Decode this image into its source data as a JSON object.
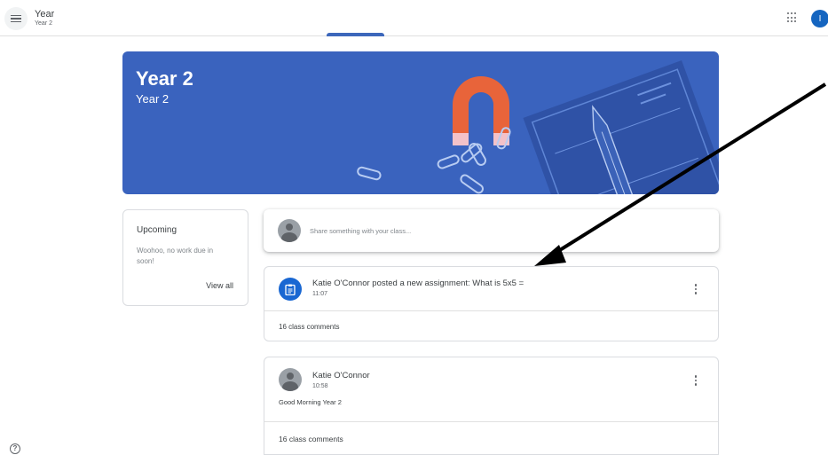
{
  "header": {
    "class_name": "Year",
    "class_section": "Year 2",
    "account_initial": "I"
  },
  "banner": {
    "title": "Year 2",
    "subtitle": "Year 2"
  },
  "upcoming": {
    "title": "Upcoming",
    "message": "Woohoo, no work due in soon!",
    "view_all": "View all"
  },
  "share": {
    "placeholder": "Share something with your class..."
  },
  "posts": [
    {
      "title": "Katie O'Connor posted a new assignment: What is 5x5 =",
      "time": "11:07",
      "comments": "16 class comments"
    },
    {
      "author": "Katie O'Connor",
      "time": "10:58",
      "body": "Good Morning Year 2",
      "comments": "16 class comments"
    }
  ],
  "help": {
    "glyph": "?"
  },
  "colors": {
    "banner": "#3a63be",
    "accent": "#1967d2",
    "account": "#1565c0"
  }
}
